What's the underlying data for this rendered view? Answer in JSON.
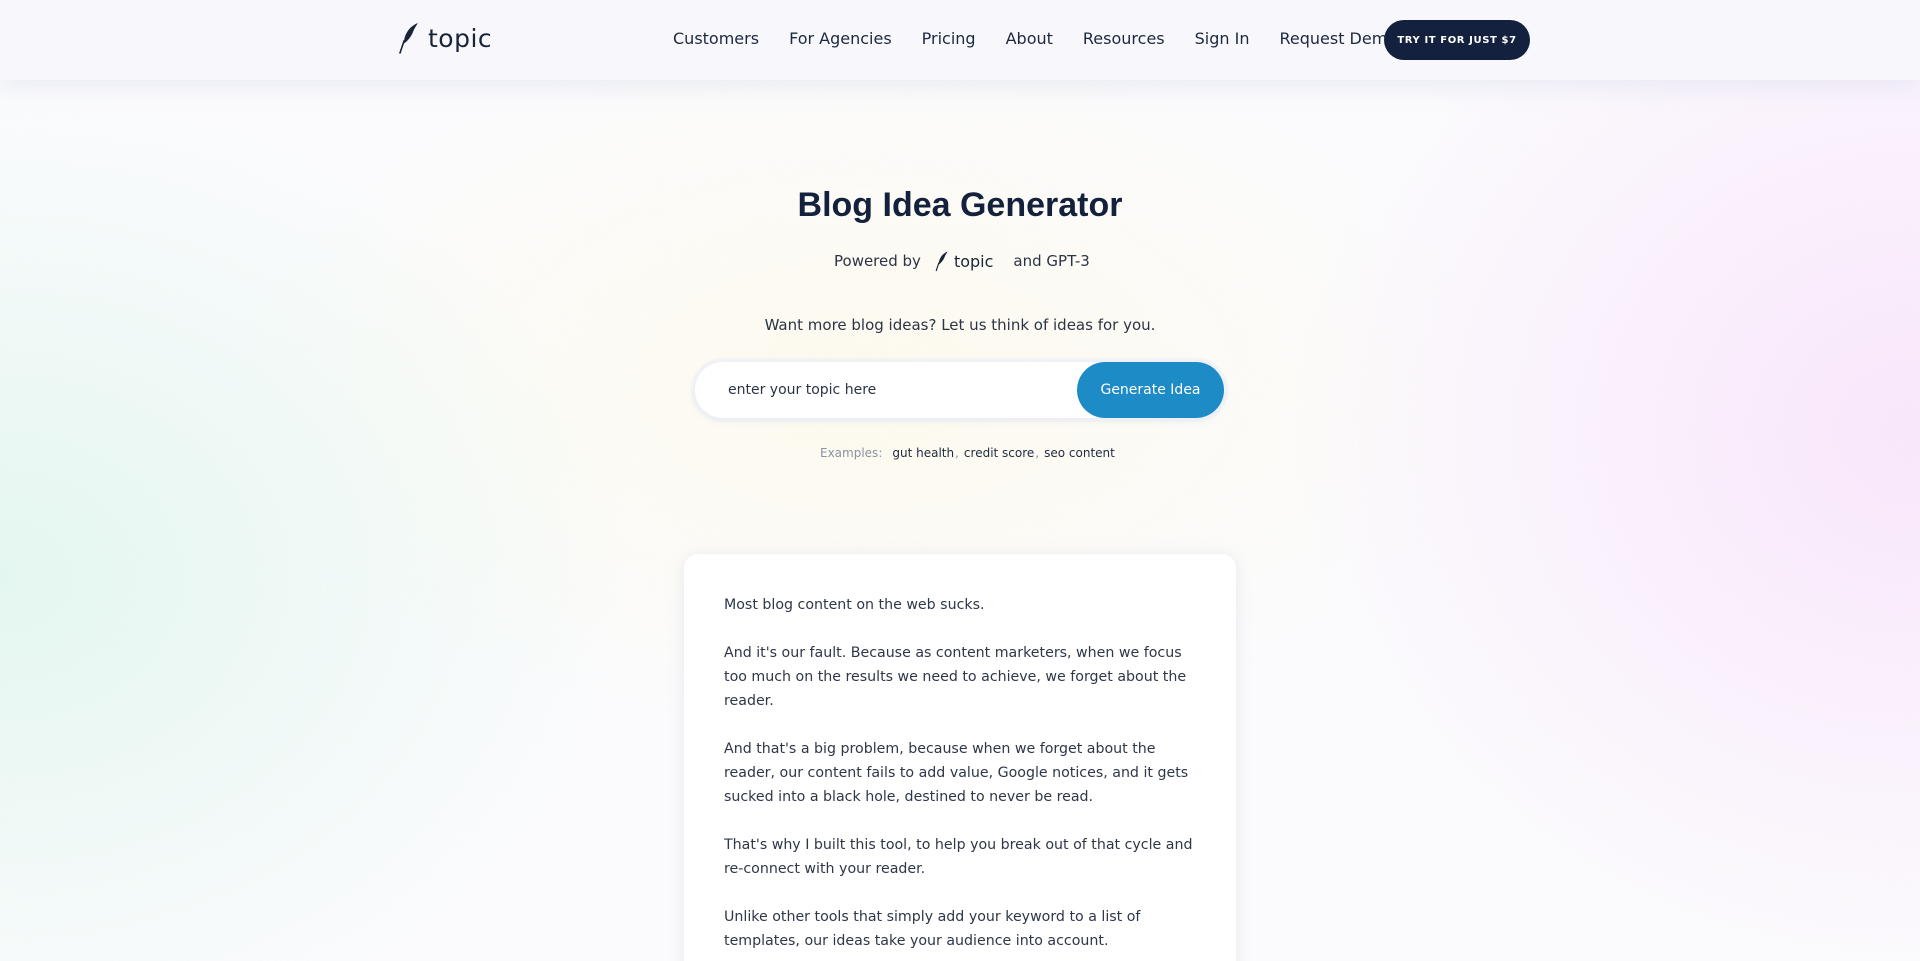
{
  "header": {
    "logo_text": "topic",
    "nav": [
      "Customers",
      "For Agencies",
      "Pricing",
      "About",
      "Resources",
      "Sign In",
      "Request Demo"
    ],
    "cta": "TRY IT FOR JUST $7"
  },
  "hero": {
    "title": "Blog Idea Generator",
    "powered_by": "Powered by",
    "powered_logo": "topic",
    "powered_suffix": "and GPT-3",
    "subtitle": "Want more blog ideas? Let us think of ideas for you.",
    "input_placeholder": "enter your topic here",
    "input_value": "",
    "button": "Generate Idea",
    "examples_label": "Examples:",
    "examples": [
      "gut health",
      "credit score",
      "seo content"
    ]
  },
  "card": {
    "paragraphs": [
      "Most blog content on the web sucks.",
      "And it's our fault. Because as content marketers, when we focus too much on the results we need to achieve, we forget about the reader.",
      "And that's a big problem, because when we forget about the reader, our content fails to add value, Google notices, and it gets sucked into a black hole, destined to never be read.",
      "That's why I built this tool, to help you break out of that cycle and re-connect with your reader.",
      "Unlike other tools that simply add your keyword to a list of templates, our ideas take your audience into account."
    ]
  },
  "colors": {
    "brand_dark": "#13213f",
    "accent_blue": "#1d8bc6"
  },
  "icons": {
    "logo": "feather-quill-icon"
  }
}
